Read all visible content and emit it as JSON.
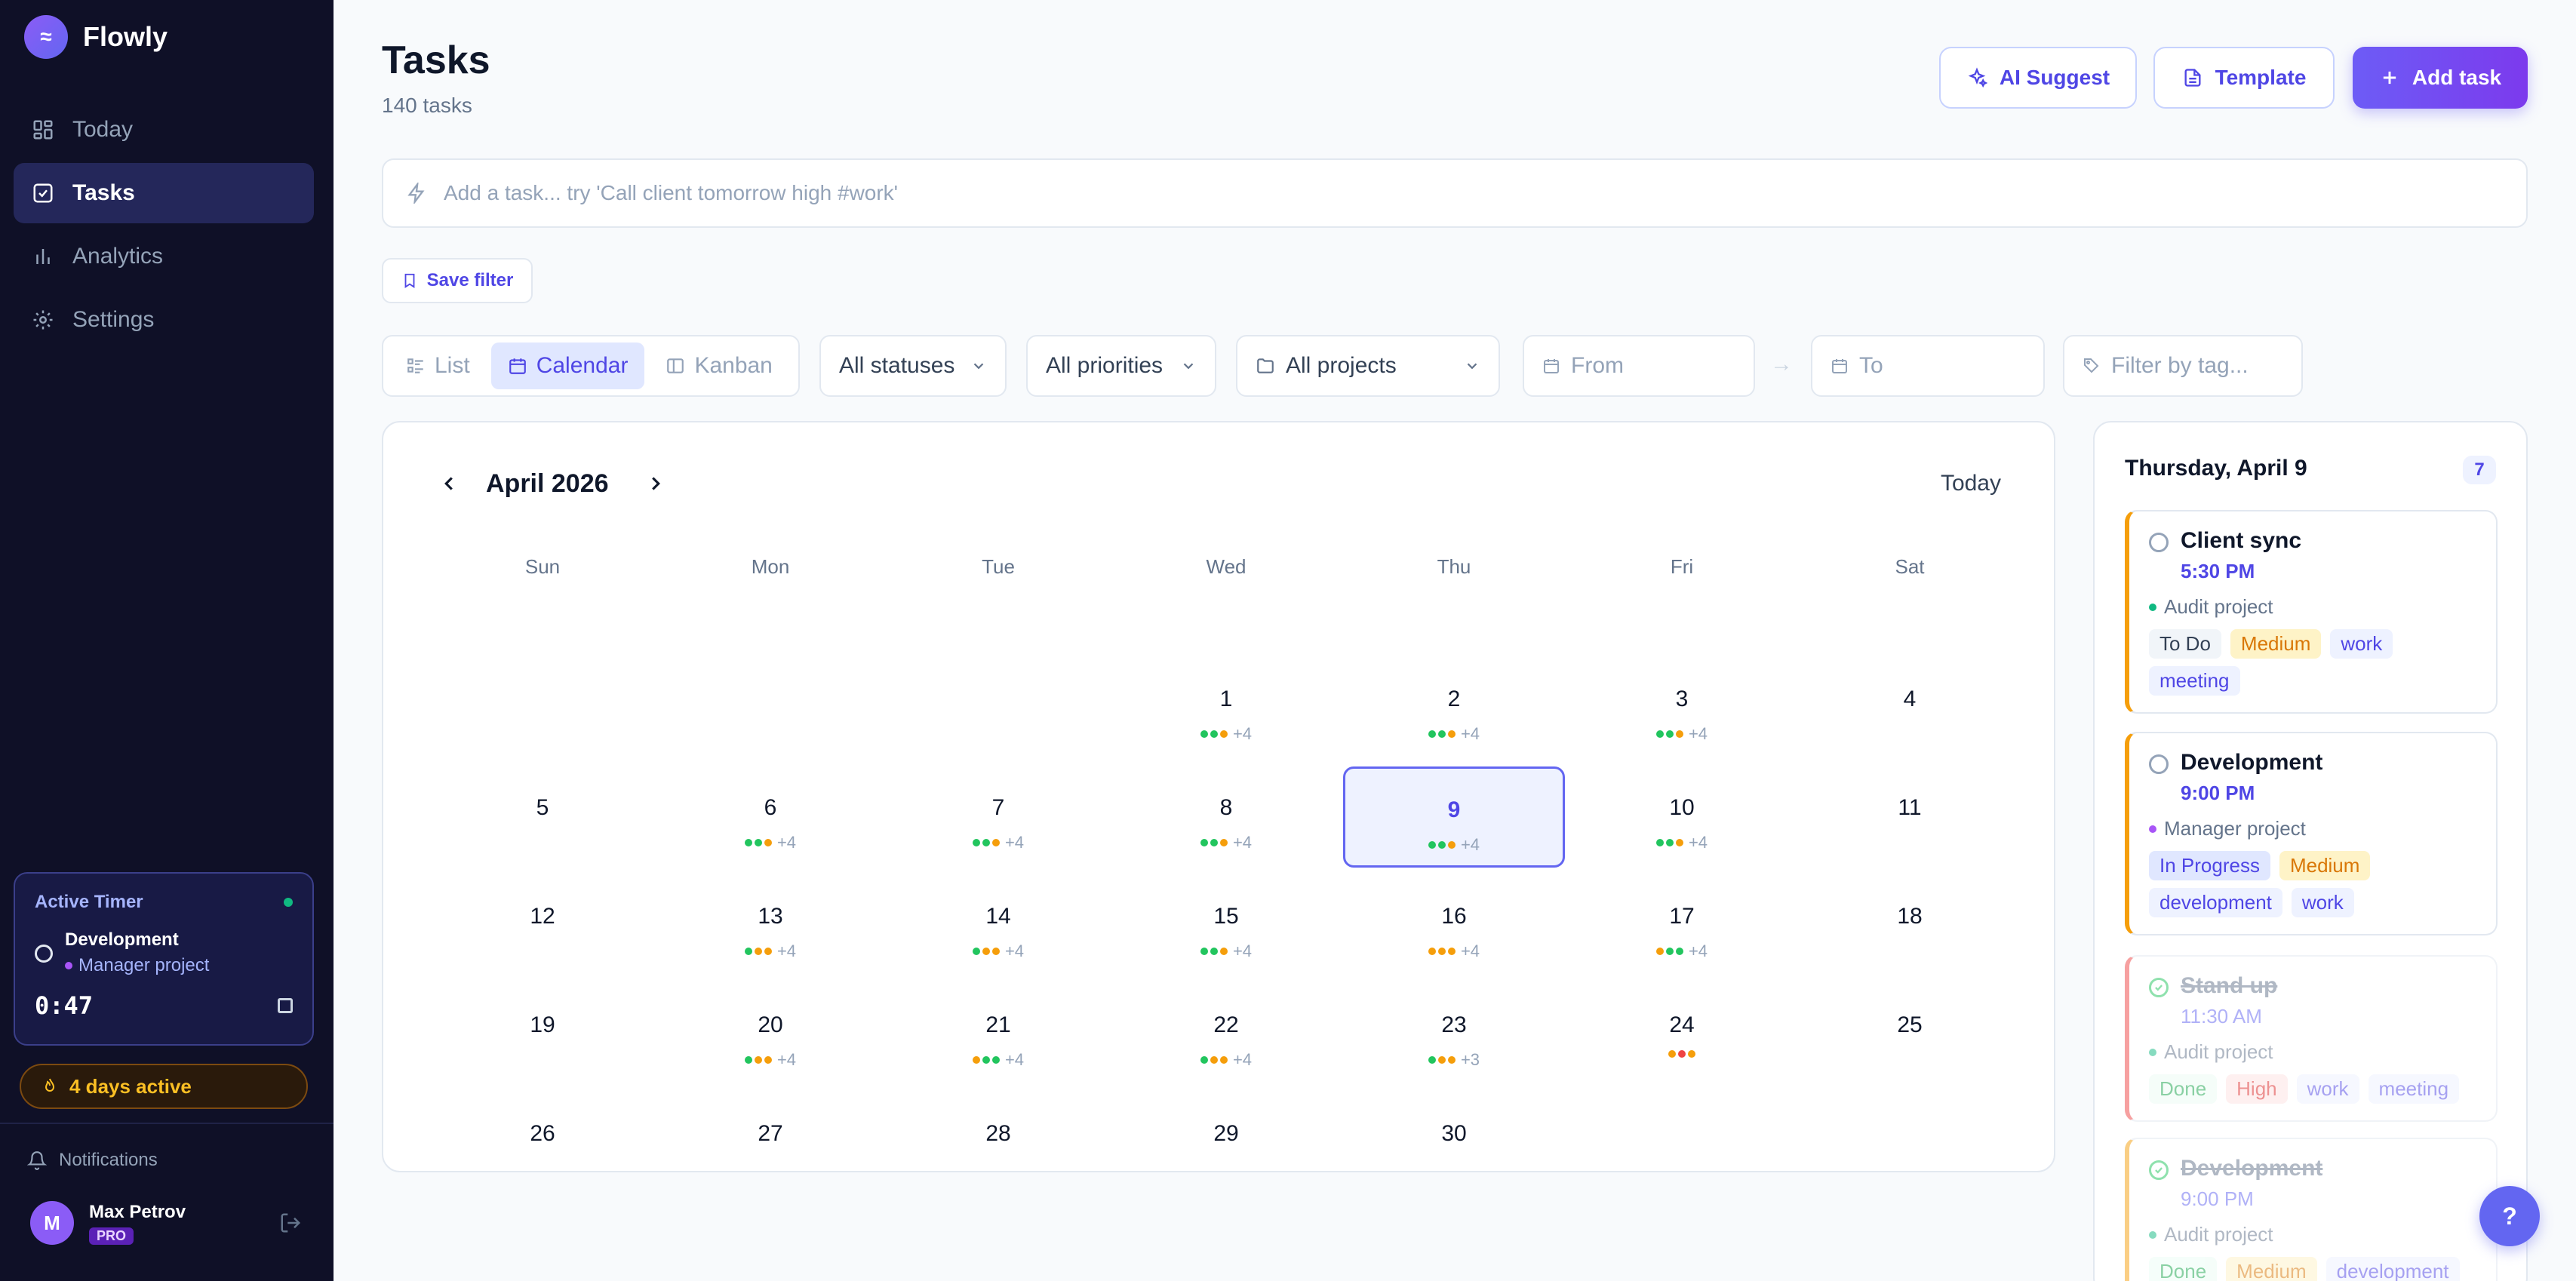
{
  "brand": {
    "logo": "≈",
    "name": "Flowly"
  },
  "sidebar": {
    "items": [
      {
        "label": "Today",
        "icon": "grid-icon"
      },
      {
        "label": "Tasks",
        "icon": "checkbox-icon"
      },
      {
        "label": "Analytics",
        "icon": "bar-chart-icon"
      },
      {
        "label": "Settings",
        "icon": "gear-icon"
      }
    ],
    "active_index": 1,
    "timer": {
      "heading": "Active Timer",
      "task": "Development",
      "project": "Manager project",
      "time": "0:47"
    },
    "streak": "4 days active",
    "notifications": "Notifications",
    "user": {
      "initial": "M",
      "name": "Max Petrov",
      "plan": "PRO"
    }
  },
  "header": {
    "title": "Tasks",
    "subtitle": "140 tasks",
    "ai_suggest": "AI Suggest",
    "template": "Template",
    "add_task": "Add task"
  },
  "quick_add": {
    "placeholder": "Add a task... try 'Call client tomorrow high #work'"
  },
  "filters": {
    "save_filter": "Save filter",
    "views": [
      "List",
      "Calendar",
      "Kanban"
    ],
    "active_view": "Calendar",
    "status": "All statuses",
    "priority": "All priorities",
    "project": "All projects",
    "from": "From",
    "to": "To",
    "tag": "Filter by tag...",
    "arrow": "→"
  },
  "calendar": {
    "month_label": "April 2026",
    "today_label": "Today",
    "weekdays": [
      "Sun",
      "Mon",
      "Tue",
      "Wed",
      "Thu",
      "Fri",
      "Sat"
    ],
    "first_weekday": 3,
    "days_in_month": 30,
    "selected_day": 9,
    "colors": {
      "green": "#22c55e",
      "orange": "#f59e0b",
      "red": "#ef4444"
    },
    "day_dots": {
      "1": {
        "dots": [
          "green",
          "green",
          "orange"
        ],
        "more": "+4"
      },
      "2": {
        "dots": [
          "green",
          "green",
          "orange"
        ],
        "more": "+4"
      },
      "3": {
        "dots": [
          "green",
          "green",
          "orange"
        ],
        "more": "+4"
      },
      "6": {
        "dots": [
          "green",
          "green",
          "orange"
        ],
        "more": "+4"
      },
      "7": {
        "dots": [
          "green",
          "green",
          "orange"
        ],
        "more": "+4"
      },
      "8": {
        "dots": [
          "green",
          "green",
          "orange"
        ],
        "more": "+4"
      },
      "9": {
        "dots": [
          "green",
          "green",
          "orange"
        ],
        "more": "+4"
      },
      "10": {
        "dots": [
          "green",
          "green",
          "orange"
        ],
        "more": "+4"
      },
      "13": {
        "dots": [
          "green",
          "orange",
          "orange"
        ],
        "more": "+4"
      },
      "14": {
        "dots": [
          "green",
          "orange",
          "orange"
        ],
        "more": "+4"
      },
      "15": {
        "dots": [
          "green",
          "green",
          "orange"
        ],
        "more": "+4"
      },
      "16": {
        "dots": [
          "orange",
          "orange",
          "orange"
        ],
        "more": "+4"
      },
      "17": {
        "dots": [
          "orange",
          "green",
          "green"
        ],
        "more": "+4"
      },
      "20": {
        "dots": [
          "green",
          "orange",
          "orange"
        ],
        "more": "+4"
      },
      "21": {
        "dots": [
          "orange",
          "green",
          "green"
        ],
        "more": "+4"
      },
      "22": {
        "dots": [
          "green",
          "orange",
          "orange"
        ],
        "more": "+4"
      },
      "23": {
        "dots": [
          "green",
          "orange",
          "orange"
        ],
        "more": "+3"
      },
      "24": {
        "dots": [
          "orange",
          "red",
          "orange"
        ],
        "more": ""
      }
    }
  },
  "day_panel": {
    "title": "Thursday, April 9",
    "count": "7",
    "tasks": [
      {
        "title": "Client sync",
        "time": "5:30 PM",
        "project": "Audit project",
        "project_color": "#10b981",
        "accent": "#f59e0b",
        "done": false,
        "tags": [
          {
            "text": "To Do",
            "kind": "status"
          },
          {
            "text": "Medium",
            "kind": "medium"
          },
          {
            "text": "work",
            "kind": "lbl"
          },
          {
            "text": "meeting",
            "kind": "lbl"
          }
        ]
      },
      {
        "title": "Development",
        "time": "9:00 PM",
        "project": "Manager project",
        "project_color": "#a855f7",
        "accent": "#f59e0b",
        "done": false,
        "tags": [
          {
            "text": "In Progress",
            "kind": "progress"
          },
          {
            "text": "Medium",
            "kind": "medium"
          },
          {
            "text": "development",
            "kind": "lbl"
          },
          {
            "text": "work",
            "kind": "lbl"
          }
        ]
      },
      {
        "title": "Stand up",
        "time": "11:30 AM",
        "project": "Audit project",
        "project_color": "#10b981",
        "accent": "#ef4444",
        "done": true,
        "tags": [
          {
            "text": "Done",
            "kind": "done-s"
          },
          {
            "text": "High",
            "kind": "high"
          },
          {
            "text": "work",
            "kind": "lbl"
          },
          {
            "text": "meeting",
            "kind": "lbl"
          }
        ]
      },
      {
        "title": "Development",
        "time": "9:00 PM",
        "project": "Audit project",
        "project_color": "#10b981",
        "accent": "#f59e0b",
        "done": true,
        "tags": [
          {
            "text": "Done",
            "kind": "done-s"
          },
          {
            "text": "Medium",
            "kind": "medium"
          },
          {
            "text": "development",
            "kind": "lbl"
          }
        ]
      }
    ]
  },
  "help": "?"
}
